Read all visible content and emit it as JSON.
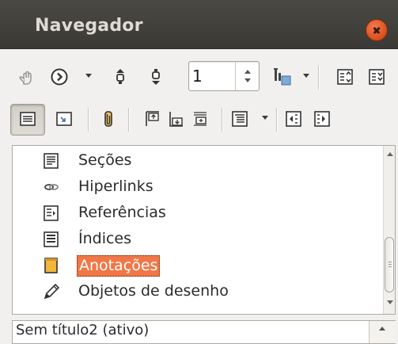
{
  "window": {
    "title": "Navegador"
  },
  "toolbar1": {
    "page_value": "1",
    "icons": [
      "navigation-toggle-icon",
      "navigate-by-icon",
      "previous-icon",
      "next-icon",
      "drag-mode-icon",
      "list-box-icon",
      "content-view-icon"
    ]
  },
  "toolbar2": {
    "icons": [
      "list-box-on-icon",
      "set-reminder-icon",
      "notes-icon",
      "header-icon",
      "footer-icon",
      "anchor-to-text-icon",
      "headings-level-icon",
      "promote-level-icon",
      "demote-level-icon"
    ]
  },
  "tree": {
    "items": [
      {
        "label": "Seções",
        "icon": "sections-icon"
      },
      {
        "label": "Hiperlinks",
        "icon": "hyperlinks-icon"
      },
      {
        "label": "Referências",
        "icon": "references-icon"
      },
      {
        "label": "Índices",
        "icon": "indexes-icon"
      },
      {
        "label": "Anotações",
        "icon": "annotations-icon",
        "selected": true
      },
      {
        "label": "Objetos de desenho",
        "icon": "drawing-objects-icon"
      }
    ]
  },
  "document_selector": {
    "value": "Sem título2 (ativo)"
  },
  "colors": {
    "titlebar": "#3f3e3a",
    "selection": "#f07746",
    "close": "#e0561f"
  }
}
